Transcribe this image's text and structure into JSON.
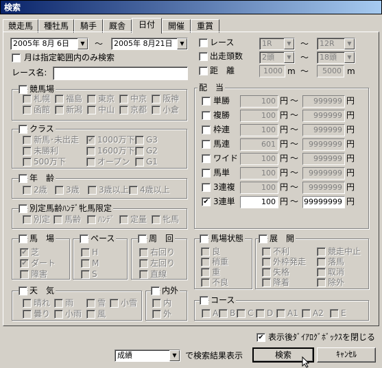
{
  "window": {
    "title": "検索"
  },
  "tabs": [
    "競走馬",
    "種牡馬",
    "騎手",
    "厩舎",
    "日付",
    "開催",
    "重賞"
  ],
  "date": {
    "from": "2005年 8月 6日",
    "to": "2005年 8月21日",
    "sep": "～",
    "month_only_label": "月は指定範囲内のみ検索"
  },
  "race_name_label": "レース名:",
  "race": {
    "label": "レース",
    "from": "1R",
    "to": "12R",
    "sep": "～"
  },
  "runners": {
    "label": "出走頭数",
    "from": "2頭",
    "to": "18頭",
    "sep": "～"
  },
  "distance": {
    "label": "距　離",
    "from": "1000",
    "to": "5000",
    "unit": "m",
    "sep": "～"
  },
  "racecourse": {
    "title": "競馬場",
    "items": [
      "札幌",
      "福島",
      "東京",
      "中京",
      "阪神",
      "函館",
      "新潟",
      "中山",
      "京都",
      "小倉"
    ]
  },
  "class": {
    "title": "クラス",
    "items": [
      "新馬･未出走",
      "1000万下",
      "G3",
      "未勝利",
      "1600万下",
      "G2",
      "500万下",
      "オープン",
      "G1"
    ],
    "checked": [
      false,
      true,
      false,
      false,
      false,
      false,
      false,
      false,
      false
    ]
  },
  "age": {
    "title": "年　齢",
    "items": [
      "2歳",
      "3歳",
      "3歳以上",
      "4歳以上"
    ]
  },
  "special": {
    "title": "別定馬齢ﾊﾝﾃﾞ牝馬限定",
    "items": [
      "別定",
      "馬齢",
      "ﾊﾝﾃﾞ",
      "定量",
      "牝馬"
    ]
  },
  "payout": {
    "title": "配　当",
    "unit": "円",
    "sep": "～",
    "rows": [
      {
        "label": "単勝",
        "from": "100",
        "to": "999999",
        "checked": false
      },
      {
        "label": "複勝",
        "from": "100",
        "to": "999999",
        "checked": false
      },
      {
        "label": "枠連",
        "from": "100",
        "to": "999999",
        "checked": false
      },
      {
        "label": "馬連",
        "from": "601",
        "to": "9999999",
        "checked": false
      },
      {
        "label": "ワイド",
        "from": "100",
        "to": "999999",
        "checked": false
      },
      {
        "label": "馬単",
        "from": "100",
        "to": "9999999",
        "checked": false
      },
      {
        "label": "3連複",
        "from": "100",
        "to": "9999999",
        "checked": false
      },
      {
        "label": "3連単",
        "from": "100",
        "to": "99999999",
        "checked": true
      }
    ]
  },
  "track": {
    "title": "馬　場",
    "items": [
      "芝",
      "ダート",
      "障害"
    ],
    "checked": [
      true,
      true,
      false
    ]
  },
  "pace": {
    "title": "ペース",
    "items": [
      "H",
      "M",
      "S"
    ]
  },
  "turn": {
    "title": "周　回",
    "items": [
      "右回り",
      "左回り",
      "直線"
    ]
  },
  "condition": {
    "title": "馬場状態",
    "items": [
      "良",
      "稍重",
      "重",
      "不良"
    ]
  },
  "development": {
    "title": "展　開",
    "items": [
      "不利",
      "競走中止",
      "外枠発走",
      "落馬",
      "失格",
      "取消",
      "降着",
      "除外"
    ]
  },
  "weather": {
    "title": "天　気",
    "items": [
      "晴れ",
      "雨",
      "雪",
      "小雪",
      "曇り",
      "小雨",
      "風"
    ]
  },
  "inout": {
    "title": "内外",
    "items": [
      "内",
      "外"
    ]
  },
  "course": {
    "title": "コース",
    "items": [
      "A",
      "B",
      "C",
      "D",
      "A1",
      "A2",
      "E"
    ]
  },
  "close_after": {
    "label": "表示後ﾀﾞｲｱﾛｸﾞﾎﾞｯｸｽを閉じる",
    "checked": true
  },
  "result": {
    "value": "成績",
    "suffix": "で検索結果表示"
  },
  "buttons": {
    "search": "検索",
    "cancel": "ｷｬﾝｾﾙ"
  },
  "icons": {
    "dropdown": "▼",
    "check": "✔"
  }
}
